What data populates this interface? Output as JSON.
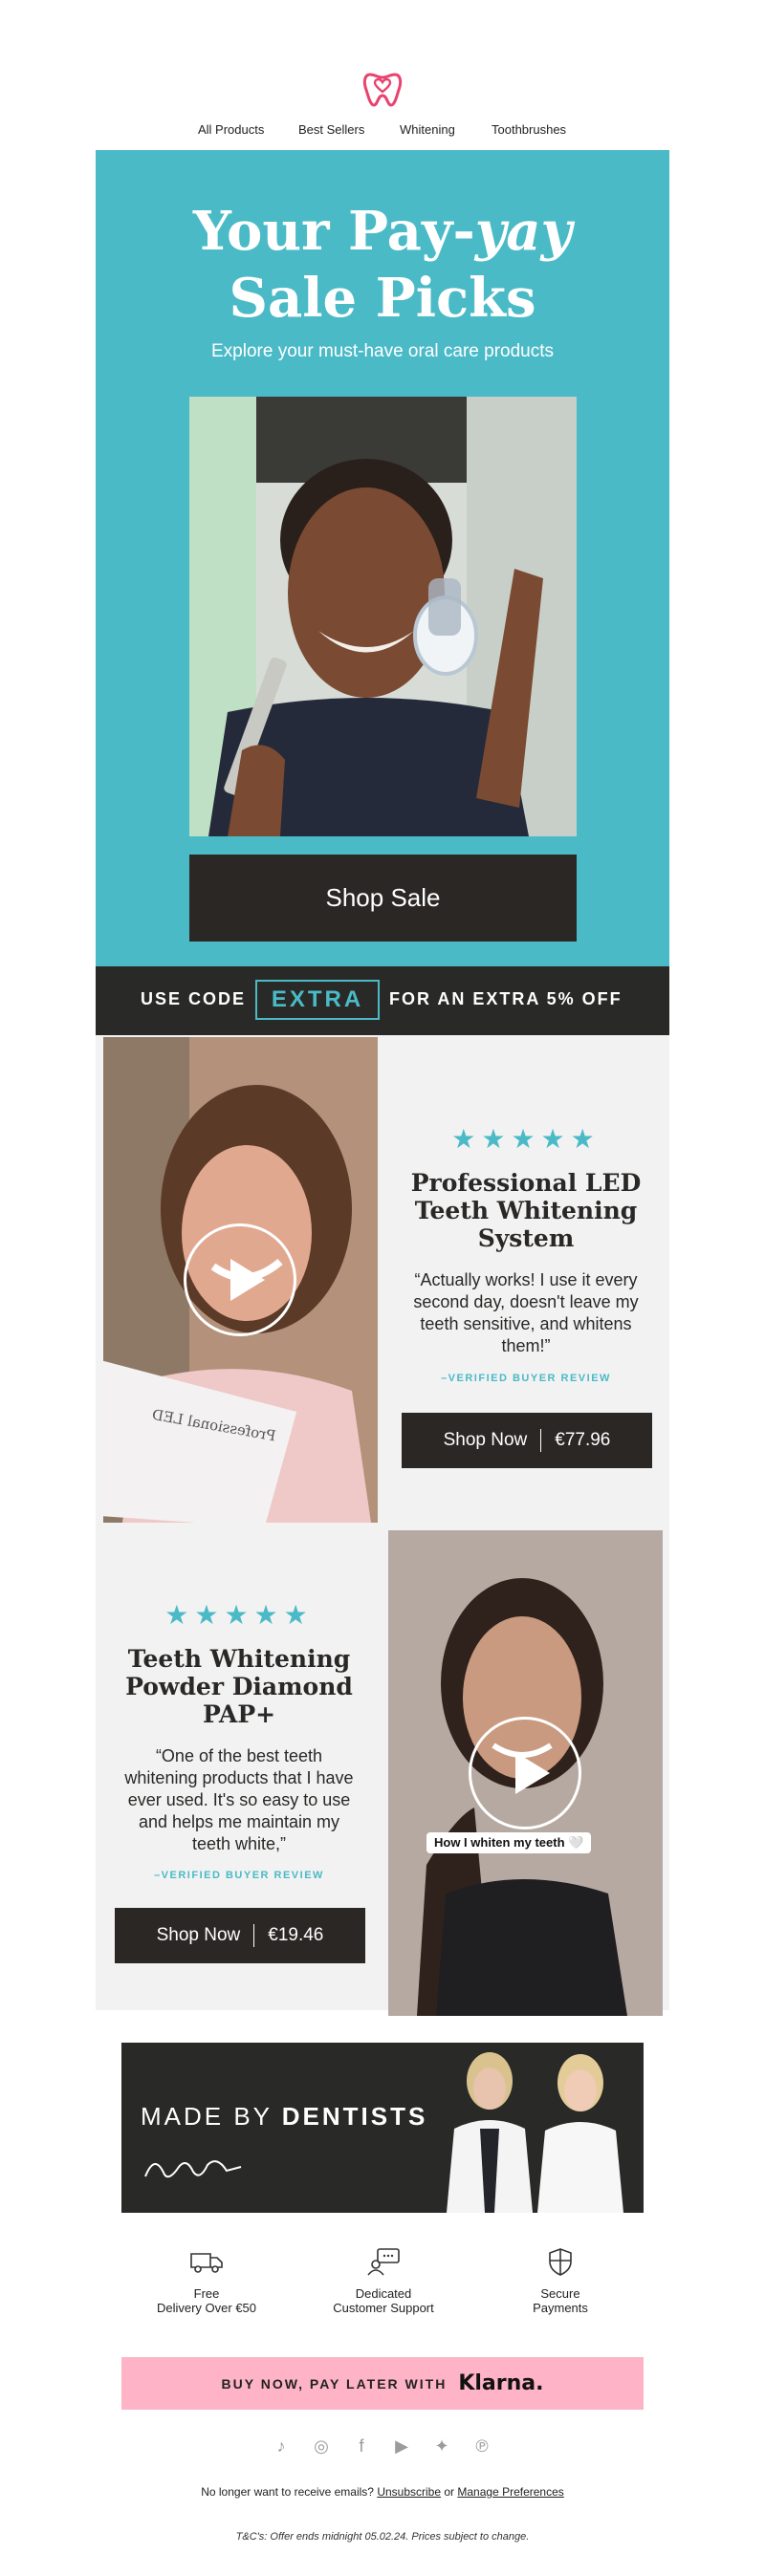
{
  "brand": {
    "logo": "tooth-heart-logo",
    "accent": "#e8436d"
  },
  "nav": {
    "items": [
      "All Products",
      "Best Sellers",
      "Whitening",
      "Toothbrushes"
    ]
  },
  "hero": {
    "title_line1_a": "Your Pay-",
    "title_line1_b": "yay",
    "title_line2": "Sale Picks",
    "subtitle": "Explore your must-have oral care products",
    "button": "Shop Sale",
    "bg": "#4bbac7"
  },
  "code_bar": {
    "prefix": "USE CODE",
    "code": "EXTRA",
    "suffix": "FOR AN EXTRA 5% OFF"
  },
  "products": [
    {
      "stars": "★★★★★",
      "title": "Professional LED Teeth Whitening System",
      "quote": "“Actually works! I use it every second day, doesn't leave my teeth sensitive, and whitens them!”",
      "verified": "–VERIFIED BUYER REVIEW",
      "button": "Shop Now",
      "price": "€77.96"
    },
    {
      "stars": "★★★★★",
      "title": "Teeth Whitening Powder Diamond PAP+",
      "quote": "“One of the best teeth whitening products that I have ever used. It's so easy to use and helps me maintain my teeth white,”",
      "verified": "–VERIFIED BUYER REVIEW",
      "button": "Shop Now",
      "price": "€19.46",
      "caption": "How I whiten my teeth 🤍"
    }
  ],
  "dentists": {
    "made_a": "MADE BY ",
    "made_b": "DENTISTS"
  },
  "features": [
    {
      "icon": "truck-icon",
      "line1": "Free",
      "line2": "Delivery Over €50"
    },
    {
      "icon": "support-icon",
      "line1": "Dedicated",
      "line2": "Customer Support"
    },
    {
      "icon": "shield-icon",
      "line1": "Secure",
      "line2": "Payments"
    }
  ],
  "klarna": {
    "text": "BUY NOW, PAY LATER WITH",
    "brand": "Klarna."
  },
  "social": [
    "tiktok-icon",
    "instagram-icon",
    "facebook-icon",
    "youtube-icon",
    "twitter-icon",
    "pinterest-icon"
  ],
  "footer": {
    "unsub_prefix": "No longer want to receive emails?",
    "unsubscribe": "Unsubscribe",
    "or": "or",
    "manage": "Manage Preferences",
    "tc": "T&C's: Offer ends midnight 05.02.24. Prices subject to change."
  }
}
